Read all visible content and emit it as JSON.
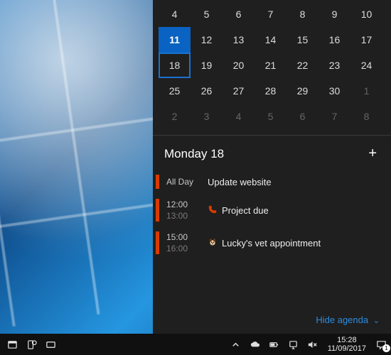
{
  "calendar": {
    "rows": [
      [
        {
          "n": "4"
        },
        {
          "n": "5"
        },
        {
          "n": "6"
        },
        {
          "n": "7"
        },
        {
          "n": "8"
        },
        {
          "n": "9"
        },
        {
          "n": "10"
        }
      ],
      [
        {
          "n": "11",
          "today": true
        },
        {
          "n": "12"
        },
        {
          "n": "13"
        },
        {
          "n": "14"
        },
        {
          "n": "15"
        },
        {
          "n": "16"
        },
        {
          "n": "17"
        }
      ],
      [
        {
          "n": "18",
          "selected": true
        },
        {
          "n": "19"
        },
        {
          "n": "20"
        },
        {
          "n": "21"
        },
        {
          "n": "22"
        },
        {
          "n": "23"
        },
        {
          "n": "24"
        }
      ],
      [
        {
          "n": "25"
        },
        {
          "n": "26"
        },
        {
          "n": "27"
        },
        {
          "n": "28"
        },
        {
          "n": "29"
        },
        {
          "n": "30"
        },
        {
          "n": "1",
          "other": true
        }
      ],
      [
        {
          "n": "2",
          "other": true
        },
        {
          "n": "3",
          "other": true
        },
        {
          "n": "4",
          "other": true
        },
        {
          "n": "5",
          "other": true
        },
        {
          "n": "6",
          "other": true
        },
        {
          "n": "7",
          "other": true
        },
        {
          "n": "8",
          "other": true
        }
      ]
    ]
  },
  "agenda": {
    "header": "Monday 18",
    "add_label": "+",
    "hide_label": "Hide agenda",
    "events": [
      {
        "all_day": true,
        "all_day_label": "All Day",
        "title": "Update website",
        "icon": "none"
      },
      {
        "all_day": false,
        "start": "12:00",
        "end": "13:00",
        "title": "Project due",
        "icon": "phone"
      },
      {
        "all_day": false,
        "start": "15:00",
        "end": "16:00",
        "title": "Lucky's vet appointment",
        "icon": "dog"
      }
    ]
  },
  "taskbar": {
    "clock_time": "15:28",
    "clock_date": "11/09/2017",
    "action_center_badge": "1"
  },
  "colors": {
    "accent": "#0a63c2",
    "event_bar": "#d83b01",
    "link": "#2b8de0"
  }
}
